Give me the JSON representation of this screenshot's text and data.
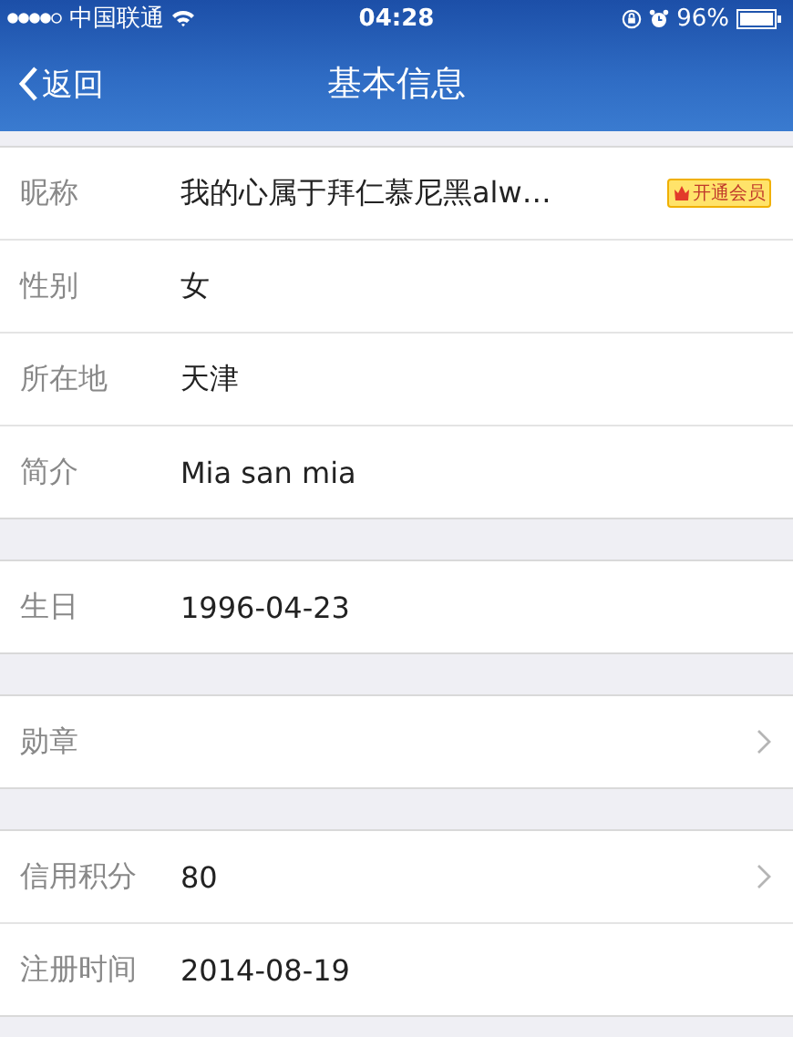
{
  "status_bar": {
    "carrier": "中国联通",
    "time": "04:28",
    "battery": "96%"
  },
  "nav": {
    "back": "返回",
    "title": "基本信息"
  },
  "groups": [
    {
      "rows": [
        {
          "label": "昵称",
          "value": "我的心属于拜仁慕尼黑alw…",
          "badge": "开通会员",
          "chevron": false
        },
        {
          "label": "性别",
          "value": "女",
          "chevron": false
        },
        {
          "label": "所在地",
          "value": "天津",
          "chevron": false
        },
        {
          "label": "简介",
          "value": "Mia san mia",
          "chevron": false
        }
      ]
    },
    {
      "rows": [
        {
          "label": "生日",
          "value": "1996-04-23",
          "chevron": false
        }
      ]
    },
    {
      "rows": [
        {
          "label": "勋章",
          "chevron": true
        }
      ]
    },
    {
      "rows": [
        {
          "label": "信用积分",
          "value": "80",
          "chevron": true
        },
        {
          "label": "注册时间",
          "value": "2014-08-19",
          "chevron": false
        }
      ]
    }
  ]
}
